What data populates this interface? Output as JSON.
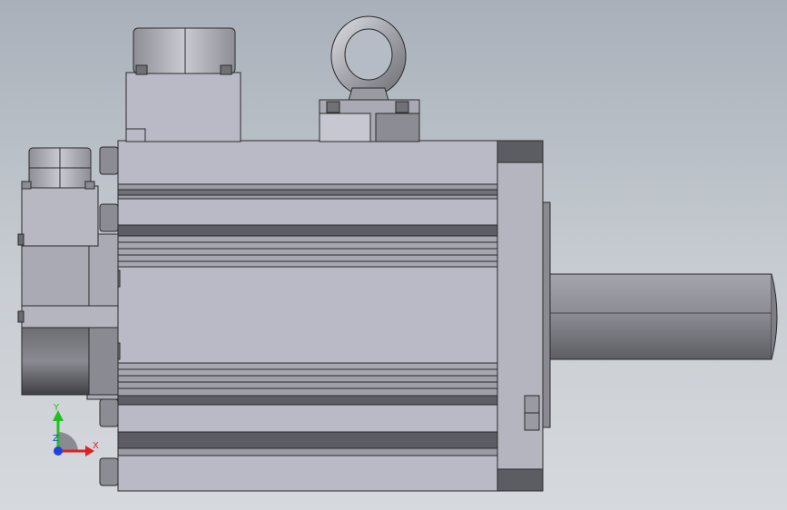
{
  "triad": {
    "x_label": "X",
    "y_label": "Y",
    "z_label": "Z",
    "x_color": "#e02020",
    "y_color": "#20c020",
    "z_color": "#2040e0"
  },
  "colors": {
    "body_fill": "#b9bac5",
    "body_stroke": "#2a2a2a",
    "dark_fill": "#5c5d63",
    "groove_fill": "#6f7078",
    "shaft_fill": "#8c8d94",
    "flange_fill": "#8a8b92"
  }
}
